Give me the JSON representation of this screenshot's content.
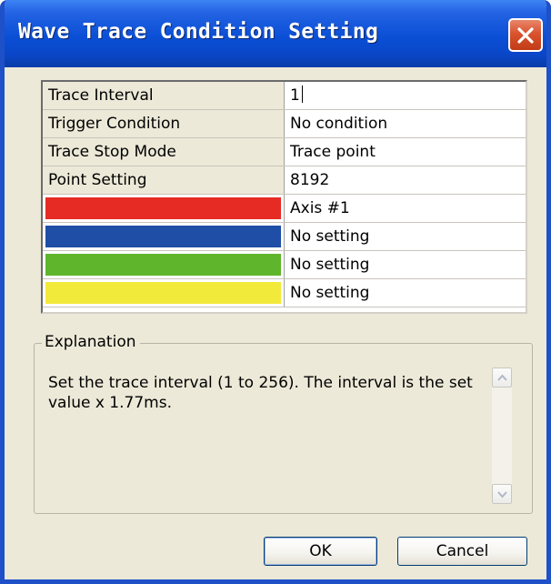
{
  "window": {
    "title": "Wave Trace Condition Setting"
  },
  "grid": {
    "rows": [
      {
        "label": "Trace Interval",
        "value": "1"
      },
      {
        "label": "Trigger Condition",
        "value": "No condition"
      },
      {
        "label": "Trace Stop Mode",
        "value": "Trace point"
      },
      {
        "label": "Point Setting",
        "value": "8192"
      },
      {
        "swatch_color": "#e62a24",
        "value": "Axis #1"
      },
      {
        "swatch_color": "#1f4ea6",
        "value": "No setting"
      },
      {
        "swatch_color": "#5fb52c",
        "value": "No setting"
      },
      {
        "swatch_color": "#f2ea3b",
        "value": "No setting"
      }
    ]
  },
  "explanation": {
    "legend": "Explanation",
    "text": "Set the trace interval (1 to 256). The interval is the set value x 1.77ms."
  },
  "buttons": {
    "ok": "OK",
    "cancel": "Cancel"
  },
  "icons": {
    "close": "close-icon",
    "scroll_up": "chevron-up-icon",
    "scroll_down": "chevron-down-icon"
  },
  "colors": {
    "titlebar": "#0a4fd6",
    "window_frame": "#1e50c8",
    "dialog_bg": "#ece9d8",
    "close_button": "#d9532e"
  }
}
